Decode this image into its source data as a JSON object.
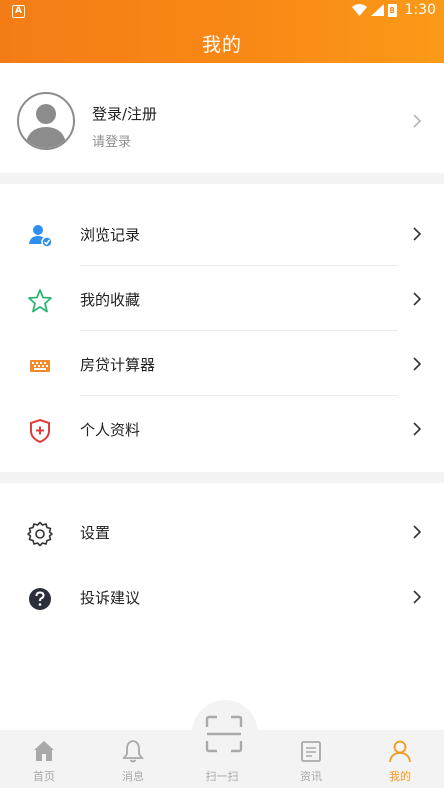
{
  "statusbar": {
    "left_badge": "A",
    "time": "1:30",
    "battery": "8"
  },
  "header": {
    "title": "我的"
  },
  "profile": {
    "title": "登录/注册",
    "subtitle": "请登录"
  },
  "menu_group1": [
    {
      "label": "浏览记录",
      "icon": "history-user-icon"
    },
    {
      "label": "我的收藏",
      "icon": "star-icon"
    },
    {
      "label": "房贷计算器",
      "icon": "calculator-icon"
    },
    {
      "label": "个人资料",
      "icon": "shield-plus-icon"
    }
  ],
  "menu_group2": [
    {
      "label": "设置",
      "icon": "gear-icon"
    },
    {
      "label": "投诉建议",
      "icon": "question-icon"
    }
  ],
  "tabbar": [
    {
      "label": "首页",
      "icon": "home-icon"
    },
    {
      "label": "消息",
      "icon": "bell-icon"
    },
    {
      "label": "扫一扫",
      "icon": "scan-icon"
    },
    {
      "label": "资讯",
      "icon": "news-icon"
    },
    {
      "label": "我的",
      "icon": "user-icon",
      "active": true
    }
  ],
  "colors": {
    "accent": "#f39a1a",
    "header_start": "#f47c16",
    "header_end": "#fb9a18"
  }
}
